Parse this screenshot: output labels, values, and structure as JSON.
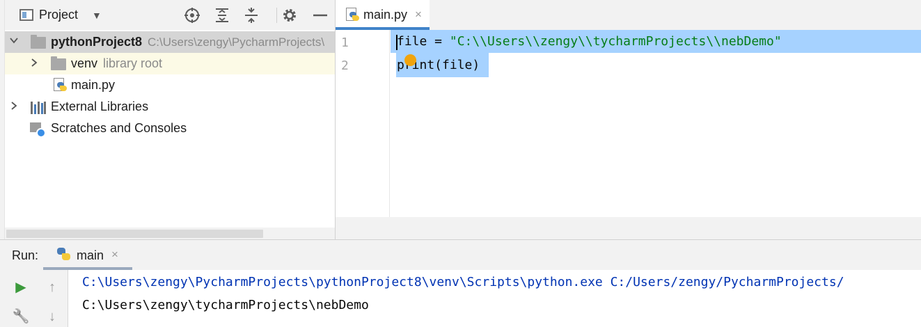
{
  "project_panel": {
    "title": "Project",
    "header_icons": [
      "locate-icon",
      "expand-all-icon",
      "collapse-all-icon",
      "gear-icon",
      "minimize-icon"
    ],
    "tree": {
      "root": {
        "name": "pythonProject8",
        "path": "C:\\Users\\zengy\\PycharmProjects\\"
      },
      "venv": {
        "name": "venv",
        "note": "library root"
      },
      "file": {
        "name": "main.py"
      },
      "external": {
        "name": "External Libraries"
      },
      "scratches": {
        "name": "Scratches and Consoles"
      }
    }
  },
  "editor": {
    "tab": {
      "label": "main.py",
      "close": "×"
    },
    "line_numbers": [
      "1",
      "2"
    ],
    "code": {
      "line1_prefix": "file = ",
      "line1_string": "\"C:\\\\Users\\\\zengy\\\\tycharmProjects\\\\nebDemo\"",
      "line2": "print(file)"
    },
    "selection_color": "#a6d2ff"
  },
  "run_panel": {
    "label": "Run:",
    "tab": {
      "label": "main",
      "close": "×"
    },
    "toolbar": {
      "run_glyph": "▶",
      "up_glyph": "↑",
      "wrench_glyph": "🔧",
      "down_glyph": "↓"
    },
    "console": {
      "lines": [
        "C:\\Users\\zengy\\PycharmProjects\\pythonProject8\\venv\\Scripts\\python.exe C:/Users/zengy/PycharmProjects/",
        "C:\\Users\\zengy\\tycharmProjects\\nebDemo"
      ],
      "text_color": "#0033b3"
    }
  }
}
